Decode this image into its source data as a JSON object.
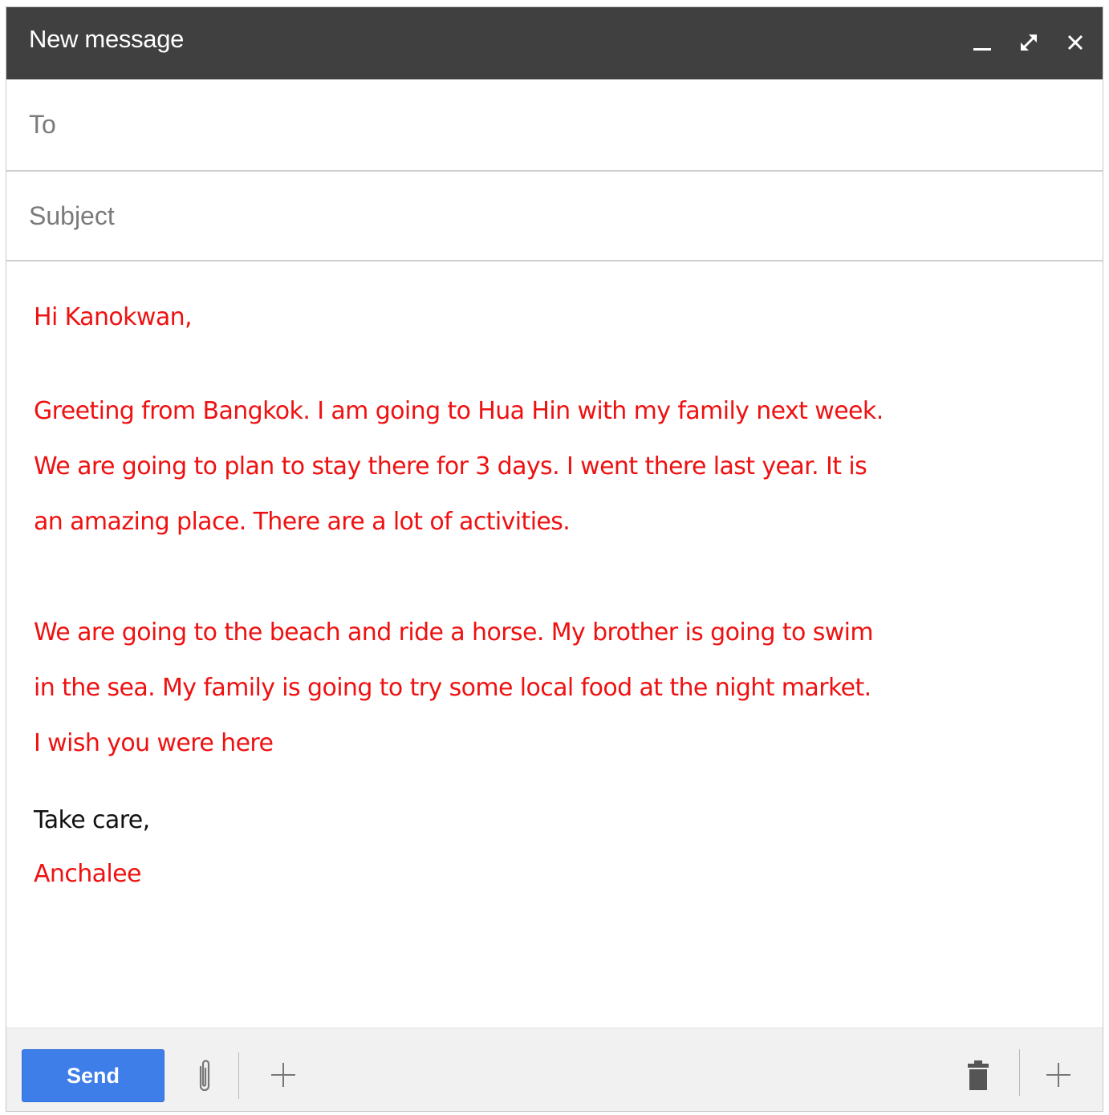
{
  "window": {
    "title": "New message"
  },
  "fields": {
    "to_placeholder": "To",
    "to_value": "",
    "subject_placeholder": "Subject",
    "subject_value": ""
  },
  "body": {
    "greeting": "Hi Kanokwan,",
    "paragraph1": [
      "Greeting from Bangkok. I am going to Hua Hin with my family next week.",
      "We are going to plan to stay there for 3 days. I went there last year. It is",
      "an amazing place. There are a lot of activities."
    ],
    "paragraph2": [
      "We are going to the beach and ride a horse. My brother is going to swim",
      "in the sea. My family is going to try some local food at the night market.",
      "I wish you were here"
    ],
    "closing": "Take care,",
    "signature": "Anchalee"
  },
  "footer": {
    "send_label": "Send"
  },
  "colors": {
    "titlebar": "#404040",
    "body_text": "#ee1111",
    "send_button": "#3d7ee8"
  },
  "icons": [
    "minimize-icon",
    "expand-icon",
    "close-icon",
    "attach-icon",
    "plus-icon",
    "trash-icon"
  ]
}
